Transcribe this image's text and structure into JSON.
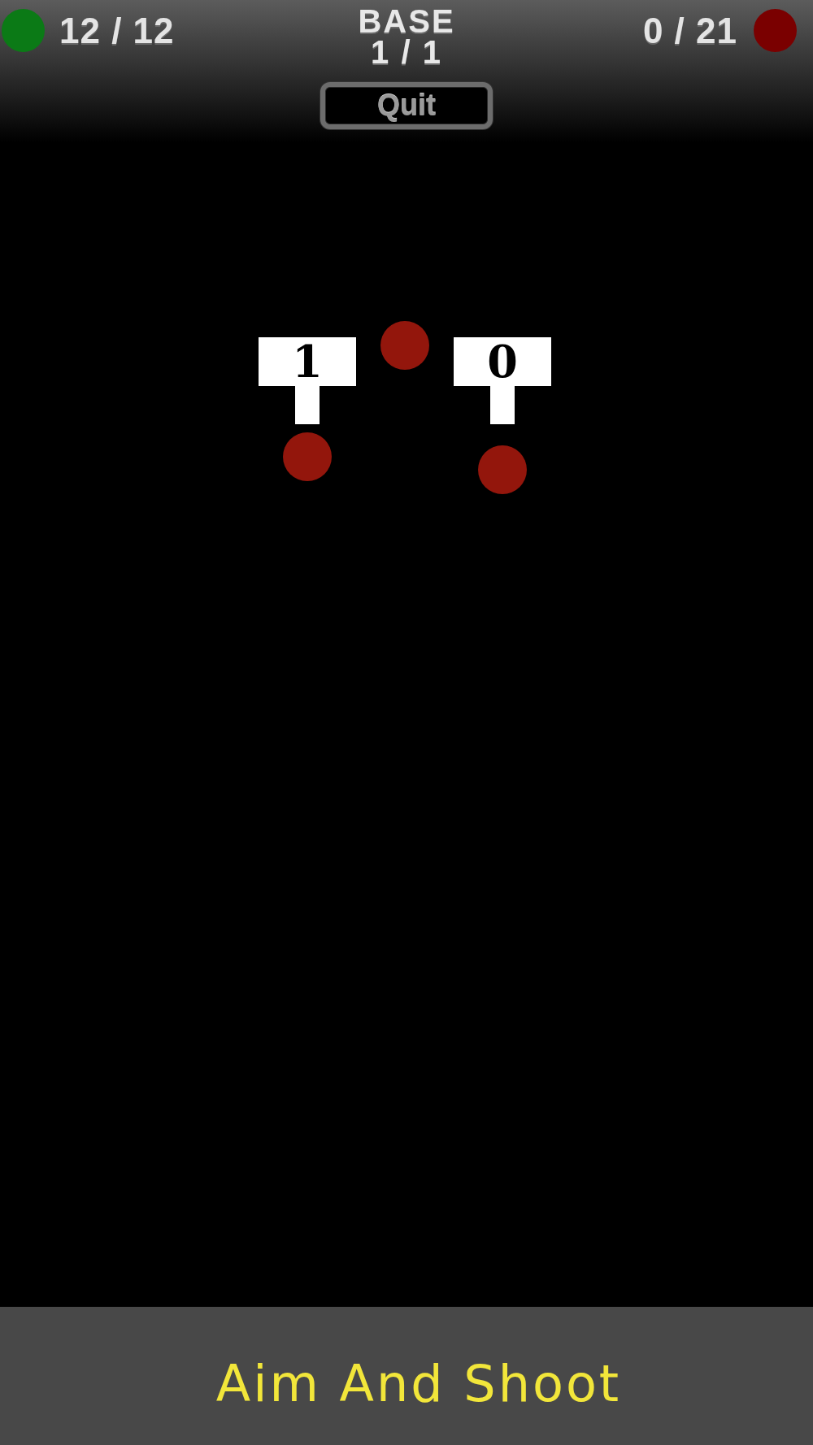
{
  "hud": {
    "sides": [
      {
        "kind": "player",
        "count": "12 / 12",
        "color": "#0b7a16"
      },
      {
        "kind": "enemy",
        "count": "0 / 21",
        "color": "#7a0000"
      }
    ],
    "title": "BASE",
    "wave": "1 / 1",
    "quit_button": "Quit"
  },
  "field": {
    "towers": [
      {
        "label": "1"
      },
      {
        "label": "0"
      }
    ]
  },
  "instruction": "Aim And Shoot"
}
